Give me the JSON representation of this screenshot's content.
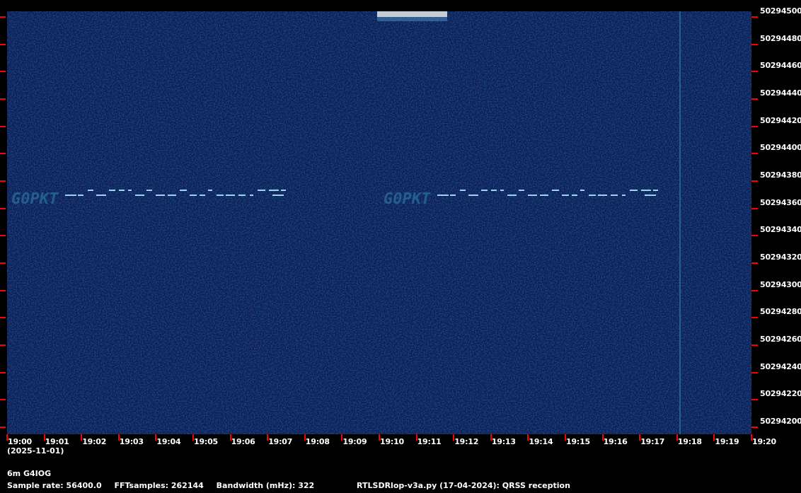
{
  "chart_data": {
    "type": "heatmap",
    "subtype": "spectrogram waterfall",
    "x_ticks": [
      "19:00",
      "19:01",
      "19:02",
      "19:03",
      "19:04",
      "19:05",
      "19:06",
      "19:07",
      "19:08",
      "19:09",
      "19:10",
      "19:11",
      "19:12",
      "19:13",
      "19:14",
      "19:15",
      "19:16",
      "19:17",
      "19:18",
      "19:19",
      "19:20"
    ],
    "x_date": "(2025-11-01)",
    "y_ticks": [
      "50294500",
      "50294480",
      "50294460",
      "50294440",
      "50294420",
      "50294400",
      "50294380",
      "50294360",
      "50294340",
      "50294320",
      "50294300",
      "50294280",
      "50294260",
      "50294240",
      "50294220",
      "50294200"
    ],
    "ylim": [
      50294200,
      50294500
    ],
    "xlim": [
      "19:00",
      "19:20"
    ],
    "signal_text": "G0PKT",
    "signals": [
      {
        "label": "G0PKT",
        "start": "19:00",
        "end": "19:07.4",
        "freq": 50294370
      },
      {
        "label": "G0PKT",
        "start": "19:10",
        "end": "19:17.4",
        "freq": 50294370
      },
      {
        "start": "19:09.9",
        "end": "19:11.8",
        "freq": 50294495,
        "note_color": "#c0c8d0"
      },
      {
        "time": "19:18.1",
        "type": "vertical line"
      }
    ],
    "colors": {
      "background": "#0a1a4a",
      "signal": "#8fd0f0",
      "ticks": "#ff0000",
      "text": "#ffffff"
    }
  },
  "footer": {
    "station": "6m G4IOG",
    "sample_rate": "Sample rate: 56400.0",
    "fft_samples": "FFTsamples: 262144",
    "bandwidth": "Bandwidth (mHz): 322",
    "program": "RTLSDRlop-v3a.py (17-04-2024): QRSS reception"
  }
}
